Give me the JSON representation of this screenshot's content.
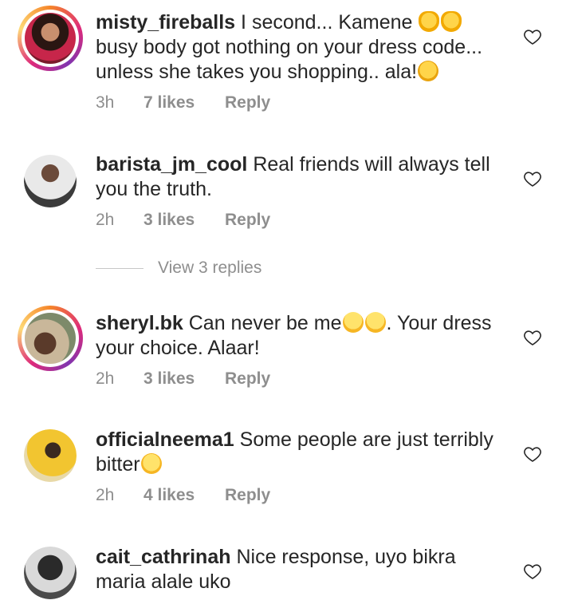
{
  "comments": [
    {
      "username": "misty_fireballs",
      "text_lines": [
        "I second... Kamene",
        "busy body got nothing on your dress code...",
        "unless she takes you shopping.. ala!"
      ],
      "time": "3h",
      "likes": "7 likes",
      "reply": "Reply",
      "avatar_ring": true
    },
    {
      "username": "barista_jm_cool",
      "text_lines": [
        "Real friends will always tell",
        "you the truth."
      ],
      "time": "2h",
      "likes": "3 likes",
      "reply": "Reply",
      "avatar_ring": false
    },
    {
      "username": "sheryl.bk",
      "text_lines": [
        "Can never be me",
        ". Your dress",
        "your choice. Alaar!"
      ],
      "time": "2h",
      "likes": "3 likes",
      "reply": "Reply",
      "avatar_ring": true
    },
    {
      "username": "officialneema1",
      "text_lines": [
        "Some people are just terribly",
        "bitter"
      ],
      "time": "2h",
      "likes": "4 likes",
      "reply": "Reply",
      "avatar_ring": false
    },
    {
      "username": "cait_cathrinah",
      "text_lines": [
        "Nice response, uyo bikra",
        "maria alale uko"
      ],
      "avatar_ring": false
    }
  ],
  "view_replies": "View 3 replies",
  "icons": {
    "like": "heart-outline-icon"
  }
}
